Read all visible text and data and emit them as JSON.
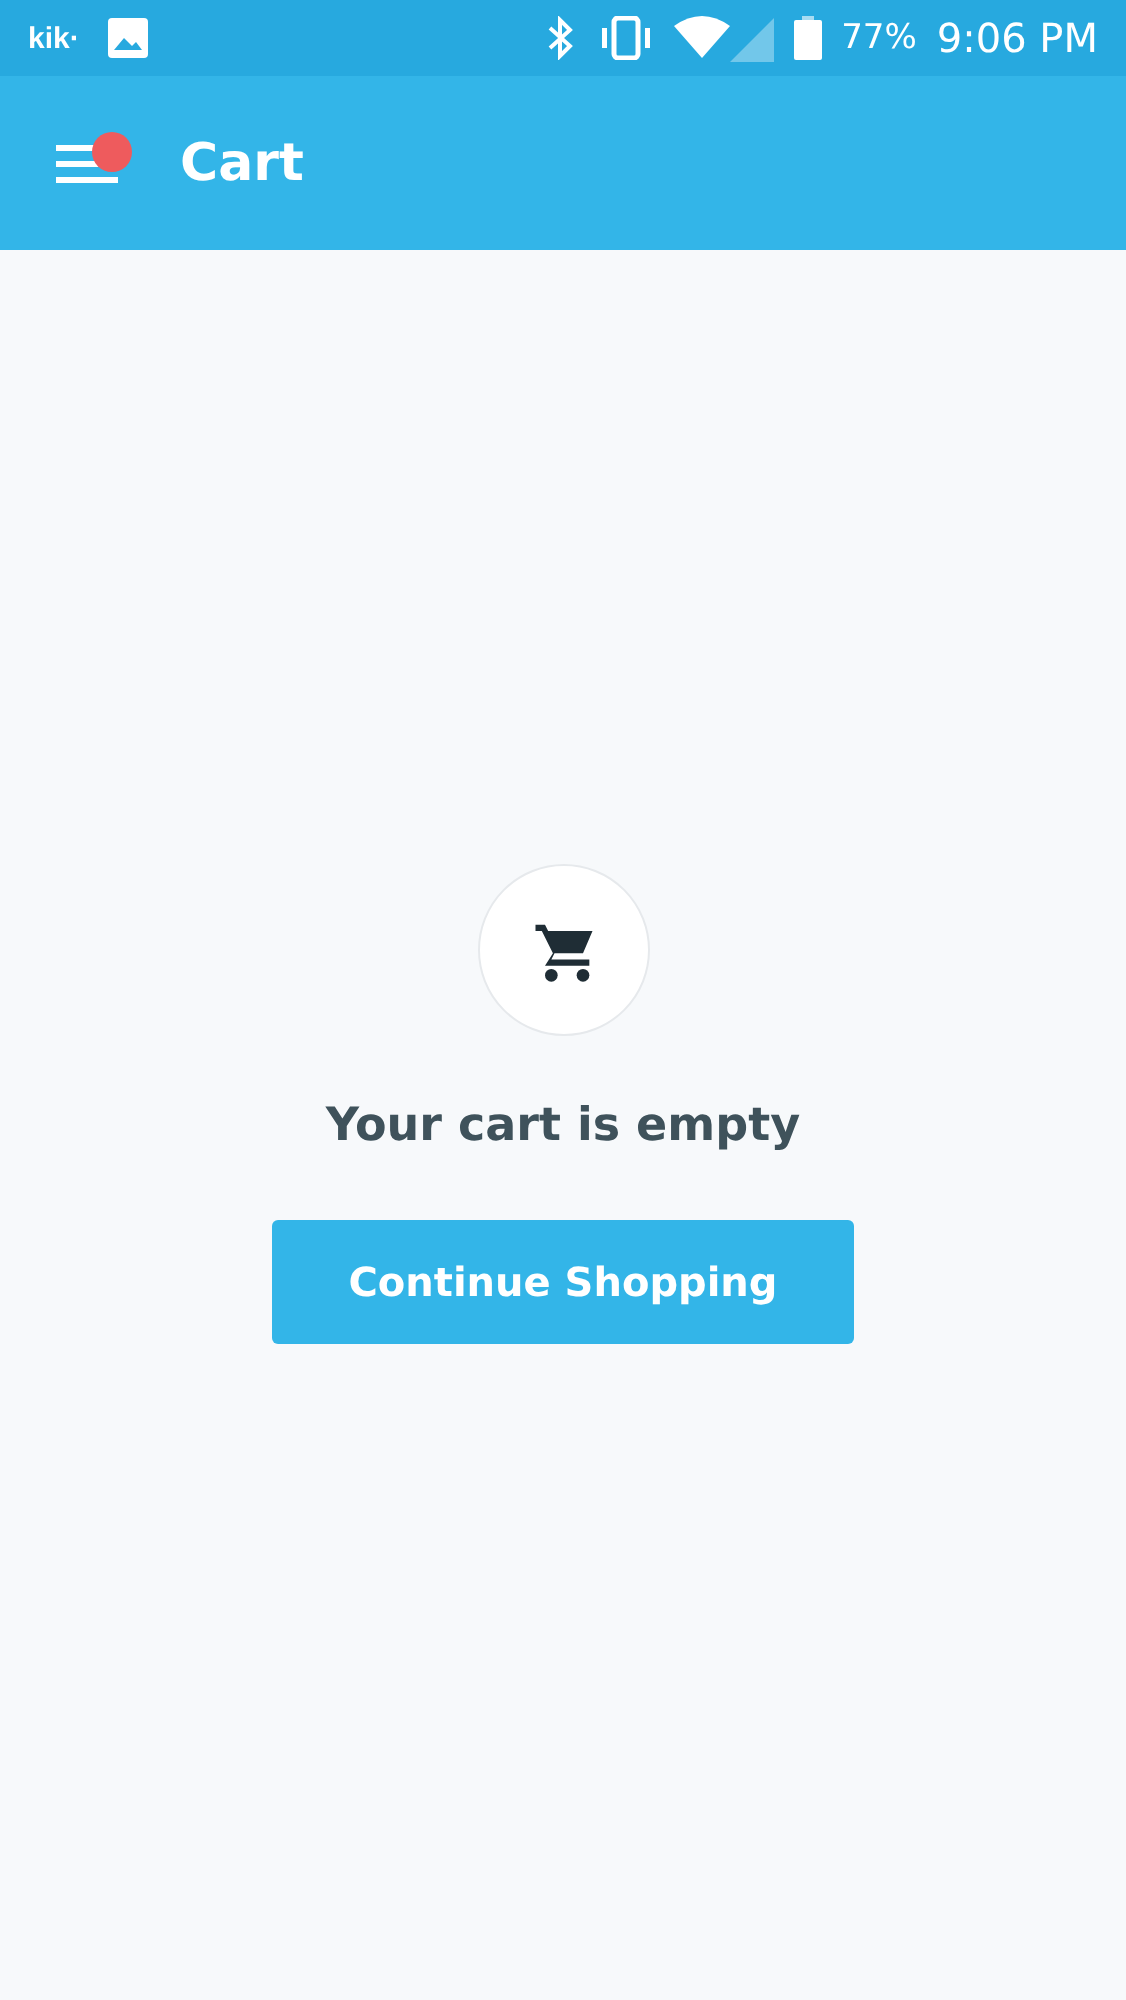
{
  "status_bar": {
    "notification_app": "kik·",
    "battery": "77%",
    "time": "9:06 PM"
  },
  "header": {
    "title": "Cart",
    "menu_badge": true
  },
  "empty_state": {
    "message": "Your cart is empty",
    "button": "Continue Shopping"
  }
}
